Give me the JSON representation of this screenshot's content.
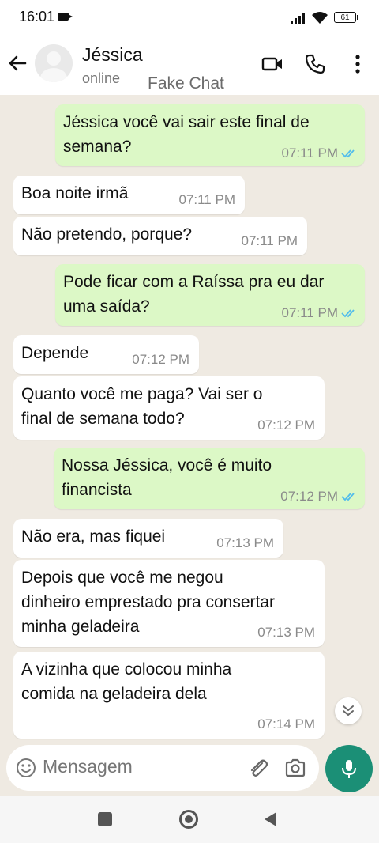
{
  "status_bar": {
    "time": "16:01",
    "battery": "61"
  },
  "header": {
    "contact_name": "Jéssica",
    "status": "online",
    "watermark": "Fake Chat"
  },
  "messages": [
    {
      "direction": "out",
      "text_lines": [
        "Jéssica você vai sair este final de",
        "semana?"
      ],
      "time": "07:11 PM"
    },
    {
      "direction": "in",
      "text_lines": [
        "Boa noite irmã"
      ],
      "time": "07:11 PM"
    },
    {
      "direction": "in",
      "text_lines": [
        "Não pretendo, porque?"
      ],
      "time": "07:11 PM"
    },
    {
      "direction": "out",
      "text_lines": [
        "Pode ficar com a Raíssa pra eu dar",
        "uma saída?"
      ],
      "time": "07:11 PM"
    },
    {
      "direction": "in",
      "text_lines": [
        "Depende"
      ],
      "time": "07:12 PM"
    },
    {
      "direction": "in",
      "text_lines": [
        "Quanto você me paga? Vai ser o",
        "final de semana todo?"
      ],
      "time": "07:12 PM"
    },
    {
      "direction": "out",
      "text_lines": [
        "Nossa Jéssica, você é muito",
        "financista"
      ],
      "time": "07:12 PM"
    },
    {
      "direction": "in",
      "text_lines": [
        "Não era, mas fiquei"
      ],
      "time": "07:13 PM"
    },
    {
      "direction": "in",
      "text_lines": [
        "Depois que você me negou",
        "dinheiro emprestado pra consertar",
        "minha geladeira"
      ],
      "time": "07:13 PM"
    },
    {
      "direction": "in",
      "text_lines": [
        "A vizinha que colocou minha",
        "comida na geladeira dela"
      ],
      "time": "07:14 PM"
    }
  ],
  "input": {
    "placeholder": "Mensagem"
  },
  "colors": {
    "incoming": "#ffffff",
    "outgoing": "#dcf8c6",
    "accent": "#1b8f76",
    "read_ticks": "#53bdeb",
    "background": "#efeae2"
  },
  "icons": [
    "back-arrow-icon",
    "video-call-icon",
    "phone-icon",
    "more-vert-icon",
    "emoji-icon",
    "attach-icon",
    "camera-icon",
    "mic-icon",
    "scroll-down-icon"
  ]
}
